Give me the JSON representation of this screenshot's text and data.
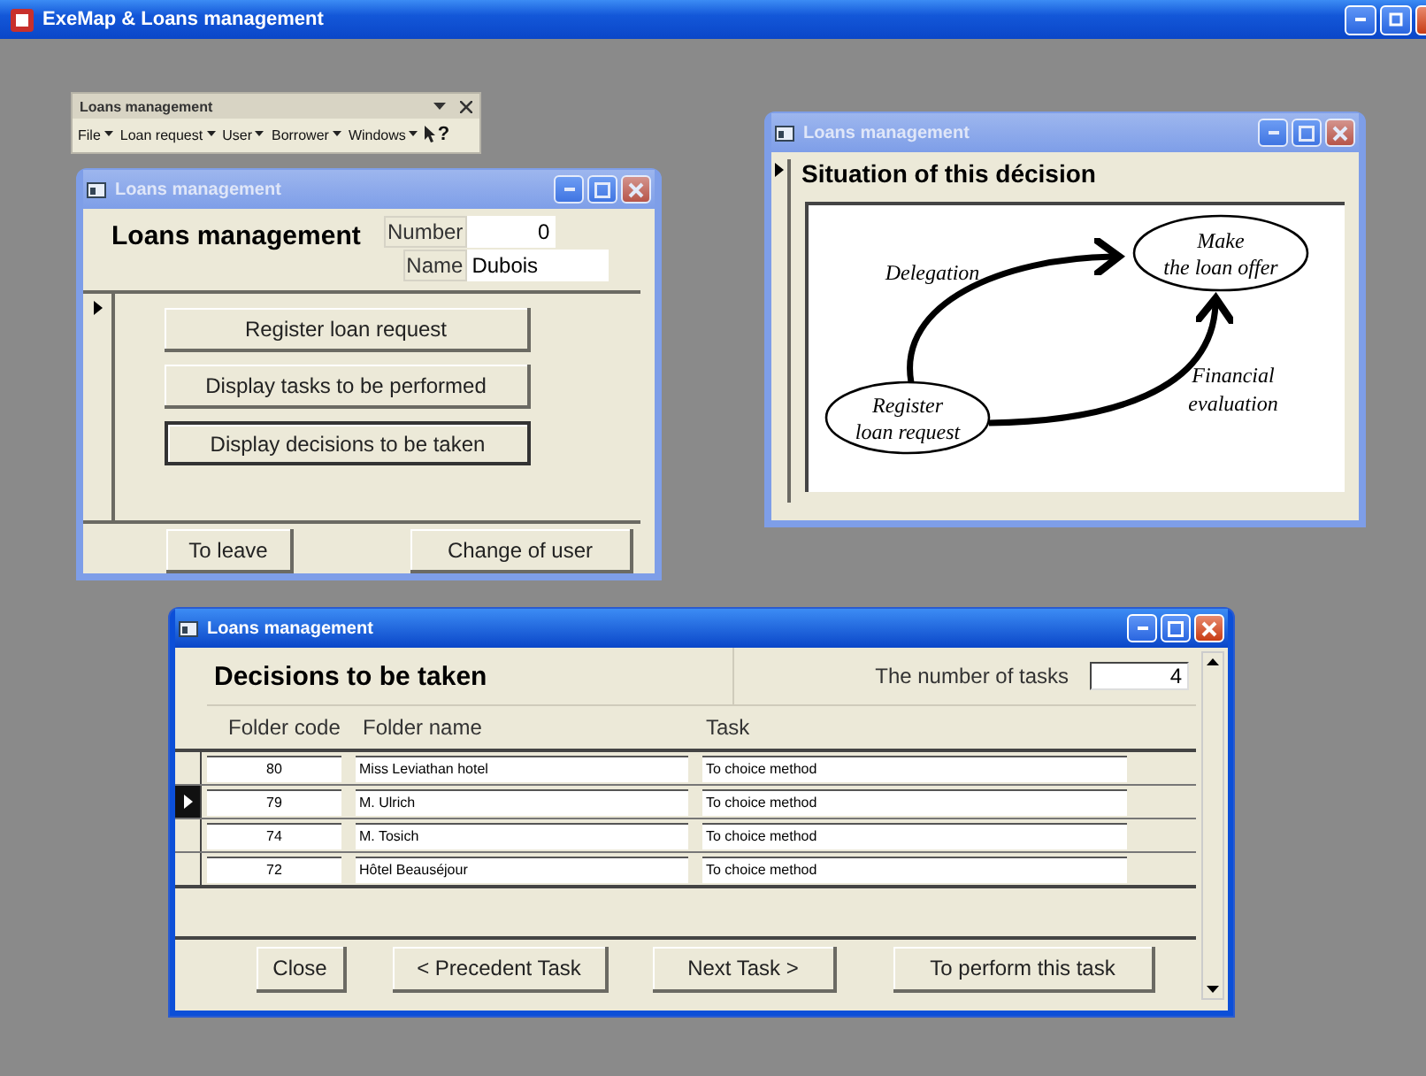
{
  "app": {
    "title": "ExeMap & Loans management"
  },
  "toolbar": {
    "title": "Loans management",
    "menus": [
      "File",
      "Loan request",
      "User",
      "Borrower",
      "Windows"
    ],
    "help": "?"
  },
  "main_window": {
    "title": "Loans management",
    "active": false,
    "heading": "Loans management",
    "number_label": "Number",
    "number": "0",
    "name_label": "Name",
    "name": "Dubois",
    "actions": [
      {
        "label": "Register loan request",
        "focused": false
      },
      {
        "label": "Display tasks to be performed",
        "focused": false
      },
      {
        "label": "Display decisions to be taken",
        "focused": true
      }
    ],
    "buttons": [
      "To leave",
      "Change of user"
    ]
  },
  "situation_window": {
    "title": "Loans management",
    "active": false,
    "heading": "Situation of this décision",
    "diagram": {
      "nodes": [
        {
          "lines": [
            "Make",
            "the loan offer"
          ]
        },
        {
          "lines": [
            "Register",
            "loan request"
          ]
        }
      ],
      "edges": [
        {
          "lines": [
            "Delegation"
          ]
        },
        {
          "lines": [
            "Financial",
            "evaluation"
          ]
        }
      ]
    }
  },
  "decisions_window": {
    "title": "Loans management",
    "active": true,
    "heading": "Decisions to be taken",
    "count_label": "The number of tasks",
    "count": "4",
    "columns": [
      "Folder code",
      "Folder name",
      "Task"
    ],
    "rows": [
      {
        "code": "80",
        "name": "Miss Leviathan hotel",
        "task": "To choice method",
        "selected": false
      },
      {
        "code": "79",
        "name": "M. Ulrich",
        "task": "To choice method",
        "selected": true
      },
      {
        "code": "74",
        "name": "M. Tosich",
        "task": "To choice method",
        "selected": false
      },
      {
        "code": "72",
        "name": "Hôtel Beauséjour",
        "task": "To choice method",
        "selected": false
      }
    ],
    "buttons": [
      "Close",
      "< Precedent Task",
      "Next Task >",
      "To perform this task"
    ]
  }
}
